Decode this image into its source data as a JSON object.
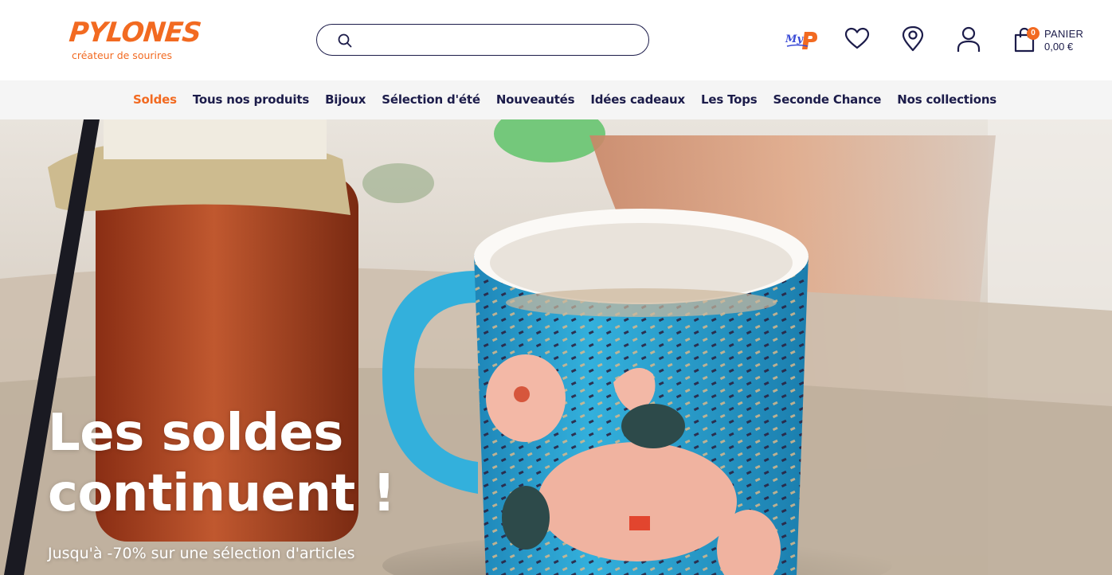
{
  "header": {
    "logo": {
      "name": "PYLONES",
      "tagline": "créateur de sourires"
    },
    "search": {
      "placeholder": "",
      "value": ""
    },
    "icons": [
      "myp-loyalty-icon",
      "heart-icon",
      "map-pin-icon",
      "user-icon",
      "shopping-bag-icon"
    ],
    "myp_label": "MyP",
    "cart": {
      "count": "0",
      "label": "PANIER",
      "total": "0,00 €"
    }
  },
  "nav": {
    "items": [
      {
        "label": "Soldes",
        "accent": true
      },
      {
        "label": "Tous nos produits"
      },
      {
        "label": "Bijoux"
      },
      {
        "label": "Sélection d'été"
      },
      {
        "label": "Nouveautés"
      },
      {
        "label": "Idées cadeaux"
      },
      {
        "label": "Les Tops"
      },
      {
        "label": "Seconde Chance"
      },
      {
        "label": "Nos collections"
      }
    ]
  },
  "hero": {
    "title": "Les soldes continuent !",
    "subtitle": "Jusqu'à -70% sur une sélection d'articles"
  },
  "colors": {
    "brand_orange": "#f26a21",
    "navy": "#1c1c4a",
    "nav_bg": "#f5f5f5",
    "mug_blue": "#2fa9d8"
  }
}
